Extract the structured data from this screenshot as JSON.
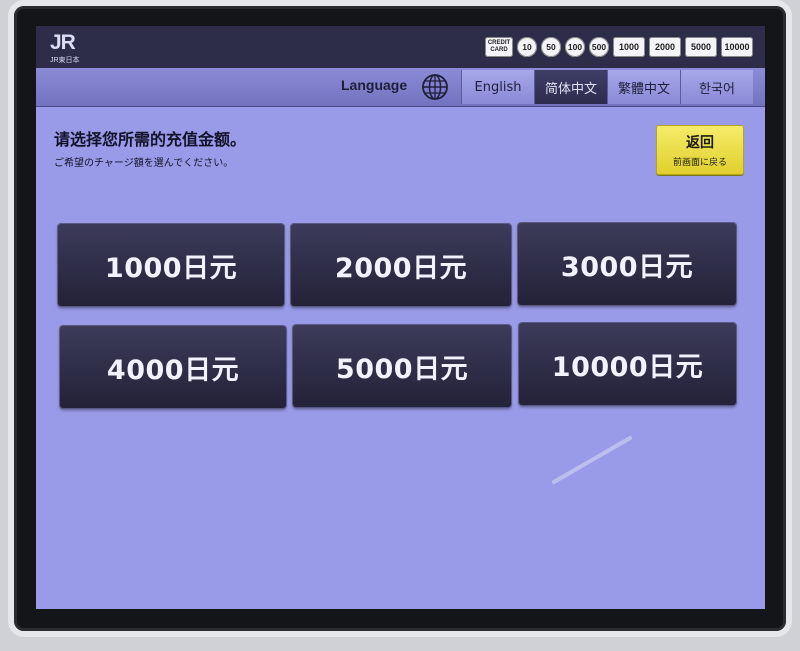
{
  "header": {
    "logo_text": "JR",
    "logo_sub": "JR東日本",
    "credit_card_label": "CREDIT CARD",
    "coins": [
      "10",
      "50",
      "100",
      "500"
    ],
    "bills": [
      "1000",
      "2000",
      "5000",
      "10000"
    ]
  },
  "language_bar": {
    "label": "Language",
    "tabs": [
      {
        "label": "English",
        "active": false
      },
      {
        "label": "简体中文",
        "active": true
      },
      {
        "label": "繁體中文",
        "active": false
      },
      {
        "label": "한국어",
        "active": false
      }
    ]
  },
  "main": {
    "instruction_zh": "请选择您所需的充值金额。",
    "instruction_ja": "ご希望のチャージ額を選んでください。",
    "back_button": {
      "label": "返回",
      "sublabel": "前画面に戻る"
    },
    "amounts": [
      "1000日元",
      "2000日元",
      "3000日元",
      "4000日元",
      "5000日元",
      "10000日元"
    ]
  },
  "colors": {
    "screen_bg": "#9a9be8",
    "button_bg": "#2b2a44",
    "back_button": "#efe24a",
    "active_tab": "#34335a"
  }
}
